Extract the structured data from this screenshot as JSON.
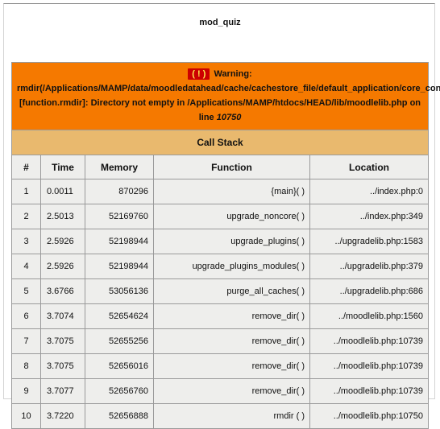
{
  "page": {
    "title": "mod_quiz"
  },
  "warning": {
    "badge": "( ! )",
    "text_before": "Warning: rmdir(/Applications/MAMP/data/moodledatahead/cache/cachestore_file/default_application/core_config) [function.rmdir]: Directory not empty in /Applications/MAMP/htdocs/HEAD/lib/moodlelib.php on line ",
    "line": "10750"
  },
  "call_stack": {
    "title": "Call Stack",
    "columns": [
      "#",
      "Time",
      "Memory",
      "Function",
      "Location"
    ],
    "rows": [
      {
        "idx": "1",
        "time": "0.0011",
        "memory": "870296",
        "func": "{main}( )",
        "loc": "../index.php:0"
      },
      {
        "idx": "2",
        "time": "2.5013",
        "memory": "52169760",
        "func": "upgrade_noncore( )",
        "loc": "../index.php:349"
      },
      {
        "idx": "3",
        "time": "2.5926",
        "memory": "52198944",
        "func": "upgrade_plugins( )",
        "loc": "../upgradelib.php:1583"
      },
      {
        "idx": "4",
        "time": "2.5926",
        "memory": "52198944",
        "func": "upgrade_plugins_modules( )",
        "loc": "../upgradelib.php:379"
      },
      {
        "idx": "5",
        "time": "3.6766",
        "memory": "53056136",
        "func": "purge_all_caches( )",
        "loc": "../upgradelib.php:686"
      },
      {
        "idx": "6",
        "time": "3.7074",
        "memory": "52654624",
        "func": "remove_dir( )",
        "loc": "../moodlelib.php:1560"
      },
      {
        "idx": "7",
        "time": "3.7075",
        "memory": "52655256",
        "func": "remove_dir( )",
        "loc": "../moodlelib.php:10739"
      },
      {
        "idx": "8",
        "time": "3.7075",
        "memory": "52656016",
        "func": "remove_dir( )",
        "loc": "../moodlelib.php:10739"
      },
      {
        "idx": "9",
        "time": "3.7077",
        "memory": "52656760",
        "func": "remove_dir( )",
        "loc": "../moodlelib.php:10739"
      },
      {
        "idx": "10",
        "time": "3.7220",
        "memory": "52656888",
        "func": "rmdir ( )",
        "loc": "../moodlelib.php:10750"
      }
    ]
  },
  "colors": {
    "warning_bg": "#f57900",
    "callstack_bg": "#e9b96e",
    "row_bg": "#eeeeec",
    "badge_bg": "#cc0000",
    "badge_fg": "#fce94f"
  }
}
